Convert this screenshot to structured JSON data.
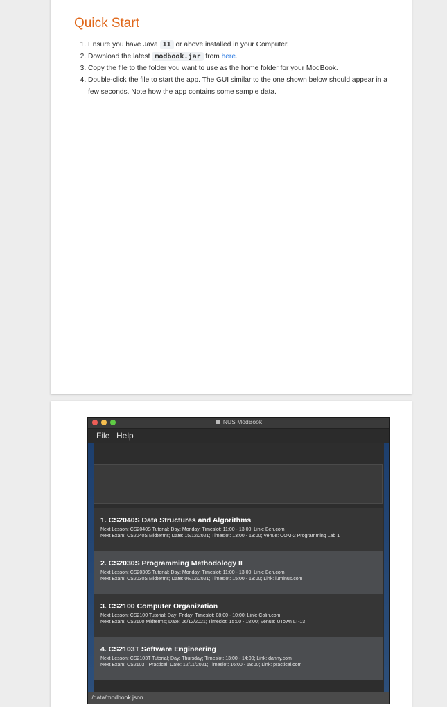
{
  "quick_start": {
    "title": "Quick Start",
    "steps": [
      {
        "before": "Ensure you have Java ",
        "code": "11",
        "after": " or above installed in your Computer."
      },
      {
        "before": "Download the latest ",
        "code": "modbook.jar",
        "middle": " from ",
        "link": "here",
        "after": "."
      },
      {
        "text": "Copy the file to the folder you want to use as the home folder for your ModBook."
      },
      {
        "text": "Double-click the file to start the app. The GUI similar to the one shown below should appear in a few seconds. Note how the app contains some sample data."
      }
    ]
  },
  "app": {
    "window_title": "NUS ModBook",
    "menu": [
      "File",
      "Help"
    ],
    "status_path": "./data/modbook.json",
    "modules": [
      {
        "name": "1.  CS2040S Data Structures and Algorithms",
        "lesson": "Next Lesson: CS2040S Tutorial; Day: Monday; Timeslot: 11:00 - 13:00; Link: Ben.com",
        "exam": "Next Exam: CS2040S Midterms; Date: 15/12/2021; Timeslot: 13:00 - 18:00; Venue: COM-2 Programming Lab 1"
      },
      {
        "name": "2.  CS2030S Programming Methodology II",
        "lesson": "Next Lesson: CS2030S Tutorial; Day: Monday; Timeslot: 11:00 - 13:00; Link: Ben.com",
        "exam": "Next Exam: CS2030S Midterms; Date: 06/12/2021; Timeslot: 15:00 - 18:00; Link: luminus.com"
      },
      {
        "name": "3.  CS2100 Computer Organization",
        "lesson": "Next Lesson: CS2100 Tutorial; Day: Friday; Timeslot: 08:00 - 10:00; Link: Colin.com",
        "exam": "Next Exam: CS2100 Midterms; Date: 06/12/2021; Timeslot: 15:00 - 18:00; Venue: UTown LT-13"
      },
      {
        "name": "4.  CS2103T Software Engineering",
        "lesson": "Next Lesson: CS2103T Tutorial; Day: Thursday; Timeslot: 13:00 - 14:00; Link: danny.com",
        "exam": "Next Exam: CS2103T Practical; Date: 12/11/2021; Timeslot: 16:00 - 18:00; Link: practical.com"
      }
    ]
  }
}
